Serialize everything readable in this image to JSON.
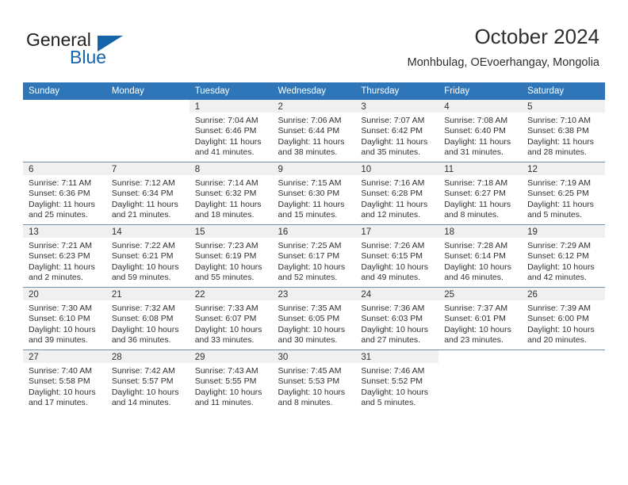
{
  "brand": {
    "name_top": "General",
    "name_bottom": "Blue"
  },
  "header": {
    "title": "October 2024",
    "location": "Monhbulag, OEvoerhangay, Mongolia"
  },
  "weekday_headers": [
    "Sunday",
    "Monday",
    "Tuesday",
    "Wednesday",
    "Thursday",
    "Friday",
    "Saturday"
  ],
  "colors": {
    "header_blue": "#2f76b9",
    "brand_blue": "#1464aa",
    "daynum_strip": "#f0f0f0",
    "row_divider": "#7490ad"
  },
  "weeks": [
    [
      {
        "day": "",
        "lines": [],
        "blank": true
      },
      {
        "day": "",
        "lines": [],
        "blank": true
      },
      {
        "day": "1",
        "lines": [
          "Sunrise: 7:04 AM",
          "Sunset: 6:46 PM",
          "Daylight: 11 hours",
          "and 41 minutes."
        ]
      },
      {
        "day": "2",
        "lines": [
          "Sunrise: 7:06 AM",
          "Sunset: 6:44 PM",
          "Daylight: 11 hours",
          "and 38 minutes."
        ]
      },
      {
        "day": "3",
        "lines": [
          "Sunrise: 7:07 AM",
          "Sunset: 6:42 PM",
          "Daylight: 11 hours",
          "and 35 minutes."
        ]
      },
      {
        "day": "4",
        "lines": [
          "Sunrise: 7:08 AM",
          "Sunset: 6:40 PM",
          "Daylight: 11 hours",
          "and 31 minutes."
        ]
      },
      {
        "day": "5",
        "lines": [
          "Sunrise: 7:10 AM",
          "Sunset: 6:38 PM",
          "Daylight: 11 hours",
          "and 28 minutes."
        ]
      }
    ],
    [
      {
        "day": "6",
        "lines": [
          "Sunrise: 7:11 AM",
          "Sunset: 6:36 PM",
          "Daylight: 11 hours",
          "and 25 minutes."
        ]
      },
      {
        "day": "7",
        "lines": [
          "Sunrise: 7:12 AM",
          "Sunset: 6:34 PM",
          "Daylight: 11 hours",
          "and 21 minutes."
        ]
      },
      {
        "day": "8",
        "lines": [
          "Sunrise: 7:14 AM",
          "Sunset: 6:32 PM",
          "Daylight: 11 hours",
          "and 18 minutes."
        ]
      },
      {
        "day": "9",
        "lines": [
          "Sunrise: 7:15 AM",
          "Sunset: 6:30 PM",
          "Daylight: 11 hours",
          "and 15 minutes."
        ]
      },
      {
        "day": "10",
        "lines": [
          "Sunrise: 7:16 AM",
          "Sunset: 6:28 PM",
          "Daylight: 11 hours",
          "and 12 minutes."
        ]
      },
      {
        "day": "11",
        "lines": [
          "Sunrise: 7:18 AM",
          "Sunset: 6:27 PM",
          "Daylight: 11 hours",
          "and 8 minutes."
        ]
      },
      {
        "day": "12",
        "lines": [
          "Sunrise: 7:19 AM",
          "Sunset: 6:25 PM",
          "Daylight: 11 hours",
          "and 5 minutes."
        ]
      }
    ],
    [
      {
        "day": "13",
        "lines": [
          "Sunrise: 7:21 AM",
          "Sunset: 6:23 PM",
          "Daylight: 11 hours",
          "and 2 minutes."
        ]
      },
      {
        "day": "14",
        "lines": [
          "Sunrise: 7:22 AM",
          "Sunset: 6:21 PM",
          "Daylight: 10 hours",
          "and 59 minutes."
        ]
      },
      {
        "day": "15",
        "lines": [
          "Sunrise: 7:23 AM",
          "Sunset: 6:19 PM",
          "Daylight: 10 hours",
          "and 55 minutes."
        ]
      },
      {
        "day": "16",
        "lines": [
          "Sunrise: 7:25 AM",
          "Sunset: 6:17 PM",
          "Daylight: 10 hours",
          "and 52 minutes."
        ]
      },
      {
        "day": "17",
        "lines": [
          "Sunrise: 7:26 AM",
          "Sunset: 6:15 PM",
          "Daylight: 10 hours",
          "and 49 minutes."
        ]
      },
      {
        "day": "18",
        "lines": [
          "Sunrise: 7:28 AM",
          "Sunset: 6:14 PM",
          "Daylight: 10 hours",
          "and 46 minutes."
        ]
      },
      {
        "day": "19",
        "lines": [
          "Sunrise: 7:29 AM",
          "Sunset: 6:12 PM",
          "Daylight: 10 hours",
          "and 42 minutes."
        ]
      }
    ],
    [
      {
        "day": "20",
        "lines": [
          "Sunrise: 7:30 AM",
          "Sunset: 6:10 PM",
          "Daylight: 10 hours",
          "and 39 minutes."
        ]
      },
      {
        "day": "21",
        "lines": [
          "Sunrise: 7:32 AM",
          "Sunset: 6:08 PM",
          "Daylight: 10 hours",
          "and 36 minutes."
        ]
      },
      {
        "day": "22",
        "lines": [
          "Sunrise: 7:33 AM",
          "Sunset: 6:07 PM",
          "Daylight: 10 hours",
          "and 33 minutes."
        ]
      },
      {
        "day": "23",
        "lines": [
          "Sunrise: 7:35 AM",
          "Sunset: 6:05 PM",
          "Daylight: 10 hours",
          "and 30 minutes."
        ]
      },
      {
        "day": "24",
        "lines": [
          "Sunrise: 7:36 AM",
          "Sunset: 6:03 PM",
          "Daylight: 10 hours",
          "and 27 minutes."
        ]
      },
      {
        "day": "25",
        "lines": [
          "Sunrise: 7:37 AM",
          "Sunset: 6:01 PM",
          "Daylight: 10 hours",
          "and 23 minutes."
        ]
      },
      {
        "day": "26",
        "lines": [
          "Sunrise: 7:39 AM",
          "Sunset: 6:00 PM",
          "Daylight: 10 hours",
          "and 20 minutes."
        ]
      }
    ],
    [
      {
        "day": "27",
        "lines": [
          "Sunrise: 7:40 AM",
          "Sunset: 5:58 PM",
          "Daylight: 10 hours",
          "and 17 minutes."
        ]
      },
      {
        "day": "28",
        "lines": [
          "Sunrise: 7:42 AM",
          "Sunset: 5:57 PM",
          "Daylight: 10 hours",
          "and 14 minutes."
        ]
      },
      {
        "day": "29",
        "lines": [
          "Sunrise: 7:43 AM",
          "Sunset: 5:55 PM",
          "Daylight: 10 hours",
          "and 11 minutes."
        ]
      },
      {
        "day": "30",
        "lines": [
          "Sunrise: 7:45 AM",
          "Sunset: 5:53 PM",
          "Daylight: 10 hours",
          "and 8 minutes."
        ]
      },
      {
        "day": "31",
        "lines": [
          "Sunrise: 7:46 AM",
          "Sunset: 5:52 PM",
          "Daylight: 10 hours",
          "and 5 minutes."
        ]
      },
      {
        "day": "",
        "lines": [],
        "blank": true
      },
      {
        "day": "",
        "lines": [],
        "blank": true
      }
    ]
  ]
}
